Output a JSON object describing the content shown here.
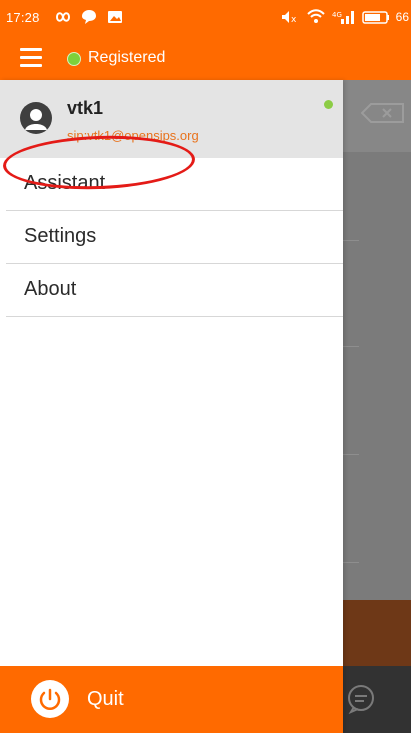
{
  "status_bar": {
    "time": "17:28",
    "battery_level": "66",
    "icons": [
      "infinity-icon",
      "chat-bubble-icon",
      "image-notification-icon",
      "volume-icon",
      "wifi-icon",
      "signal-icon",
      "battery-icon"
    ]
  },
  "app_bar": {
    "status_text": "Registered",
    "status_color": "#7dd13b",
    "accent_color": "#ff6a00"
  },
  "account": {
    "name": "vtk1",
    "sip_address": "sip:vtk1@opensips.org",
    "presence_color": "#8ccc45"
  },
  "menu": {
    "items": [
      {
        "label": "Assistant"
      },
      {
        "label": "Settings"
      },
      {
        "label": "About"
      }
    ]
  },
  "quit": {
    "label": "Quit"
  }
}
